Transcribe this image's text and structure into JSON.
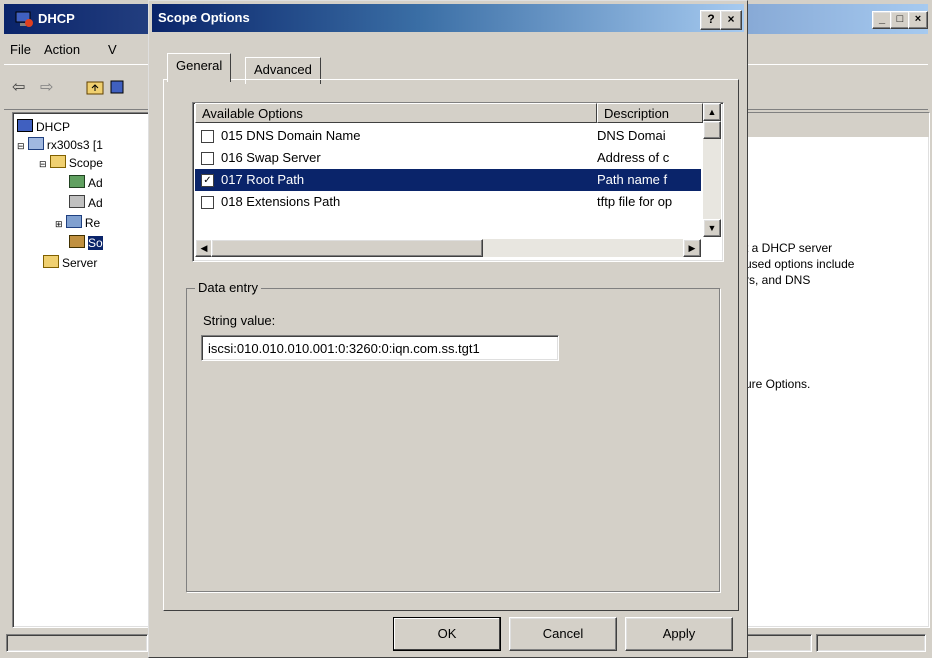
{
  "main_window": {
    "title": "DHCP",
    "controls": [
      "_",
      "□",
      "×"
    ],
    "menu": [
      {
        "label": "File"
      },
      {
        "label": "Action"
      },
      {
        "label": "V"
      }
    ],
    "toolbar": [
      "back-icon",
      "forward-icon",
      "up-folder-icon",
      "console-icon"
    ],
    "tree": [
      {
        "label": "DHCP",
        "icon": "dhcp-icon"
      },
      {
        "label": "rx300s3 [1",
        "icon": "server-icon"
      },
      {
        "label": "Scope",
        "icon": "folder-icon"
      },
      {
        "label": "Ad",
        "icon": "address-pool-icon"
      },
      {
        "label": "Ad",
        "icon": "address-leases-icon"
      },
      {
        "label": "Re",
        "icon": "reservations-icon"
      },
      {
        "label": "So",
        "icon": "scope-options-icon"
      },
      {
        "label": "Server",
        "icon": "folder-icon"
      }
    ],
    "right_text": [
      "t a DHCP server",
      "used options include",
      "rs, and DNS",
      "ure Options."
    ]
  },
  "dialog": {
    "title": "Scope Options",
    "controls": [
      "?",
      "×"
    ],
    "tabs": [
      {
        "label": "General"
      },
      {
        "label": "Advanced"
      }
    ],
    "list": {
      "col_available": "Available Options",
      "col_description": "Description",
      "rows": [
        {
          "checked": false,
          "name": "015 DNS Domain Name",
          "desc": "DNS Domai"
        },
        {
          "checked": false,
          "name": "016 Swap Server",
          "desc": "Address of c"
        },
        {
          "checked": true,
          "name": "017 Root Path",
          "desc": "Path name f",
          "selected": true
        },
        {
          "checked": false,
          "name": "018 Extensions Path",
          "desc": "tftp file for op"
        }
      ]
    },
    "data_entry": {
      "legend": "Data entry",
      "string_label": "String value:",
      "string_value": "iscsi:010.010.010.001:0:3260:0:iqn.com.ss.tgt1"
    },
    "buttons": {
      "ok": "OK",
      "cancel": "Cancel",
      "apply": "Apply"
    }
  },
  "colors": {
    "selection": "#0a246a",
    "title_active": "#0a246a",
    "face": "#d4d0c8"
  }
}
